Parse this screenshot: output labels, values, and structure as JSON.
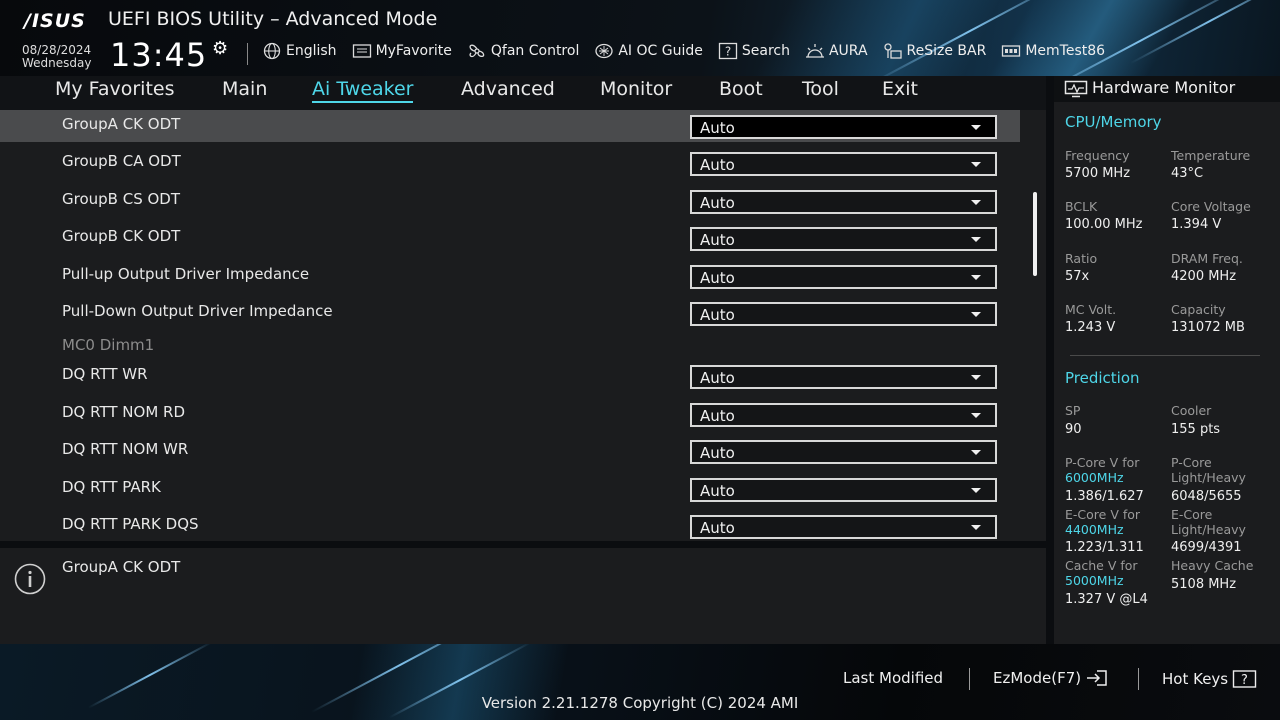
{
  "header": {
    "logo": "/ISUS",
    "title": "UEFI BIOS Utility – Advanced Mode",
    "date": "08/28/2024",
    "weekday": "Wednesday",
    "time": "13:45",
    "toolbar": [
      {
        "label": "English",
        "icon": "globe-icon"
      },
      {
        "label": "MyFavorite",
        "icon": "favorite-icon"
      },
      {
        "label": "Qfan Control",
        "icon": "fan-icon"
      },
      {
        "label": "AI OC Guide",
        "icon": "ai-oc-guide-icon"
      },
      {
        "label": "Search",
        "icon": "search-icon"
      },
      {
        "label": "AURA",
        "icon": "aura-icon"
      },
      {
        "label": "ReSize BAR",
        "icon": "resize-bar-icon"
      },
      {
        "label": "MemTest86",
        "icon": "memtest-icon"
      }
    ]
  },
  "tabs": [
    "My Favorites",
    "Main",
    "Ai Tweaker",
    "Advanced",
    "Monitor",
    "Boot",
    "Tool",
    "Exit"
  ],
  "active_tab": "Ai Tweaker",
  "settings": {
    "rows": [
      {
        "label": "GroupA CK ODT",
        "value": "Auto",
        "selected": true
      },
      {
        "label": "GroupB CA ODT",
        "value": "Auto"
      },
      {
        "label": "GroupB CS ODT",
        "value": "Auto"
      },
      {
        "label": "GroupB CK ODT",
        "value": "Auto"
      },
      {
        "label": "Pull-up Output Driver Impedance",
        "value": "Auto"
      },
      {
        "label": "Pull-Down Output Driver Impedance",
        "value": "Auto"
      }
    ],
    "section": "MC0 Dimm1",
    "rows2": [
      {
        "label": "DQ RTT WR",
        "value": "Auto"
      },
      {
        "label": "DQ RTT NOM RD",
        "value": "Auto"
      },
      {
        "label": "DQ RTT NOM WR",
        "value": "Auto"
      },
      {
        "label": "DQ RTT PARK",
        "value": "Auto"
      },
      {
        "label": "DQ RTT PARK DQS",
        "value": "Auto"
      }
    ]
  },
  "help": {
    "text": "GroupA CK ODT"
  },
  "hardware_monitor": {
    "title": "Hardware Monitor",
    "cpu_memory": {
      "heading": "CPU/Memory",
      "frequency_label": "Frequency",
      "frequency": "5700 MHz",
      "temperature_label": "Temperature",
      "temperature": "43°C",
      "bclk_label": "BCLK",
      "bclk": "100.00 MHz",
      "core_voltage_label": "Core Voltage",
      "core_voltage": "1.394 V",
      "ratio_label": "Ratio",
      "ratio": "57x",
      "dram_freq_label": "DRAM Freq.",
      "dram_freq": "4200 MHz",
      "mc_volt_label": "MC Volt.",
      "mc_volt": "1.243 V",
      "capacity_label": "Capacity",
      "capacity": "131072 MB"
    },
    "prediction": {
      "heading": "Prediction",
      "sp_label": "SP",
      "sp": "90",
      "cooler_label": "Cooler",
      "cooler": "155 pts",
      "pcore_label": "P-Core V for",
      "pcore_freq": "6000MHz",
      "pcore_v": "1.386/1.627",
      "pcore_lh_label1": "P-Core",
      "pcore_lh_label2": "Light/Heavy",
      "pcore_lh": "6048/5655",
      "ecore_label": "E-Core V for",
      "ecore_freq": "4400MHz",
      "ecore_v": "1.223/1.311",
      "ecore_lh_label1": "E-Core",
      "ecore_lh_label2": "Light/Heavy",
      "ecore_lh": "4699/4391",
      "cache_label": "Cache V for",
      "cache_freq": "5000MHz",
      "cache_v": "1.327 V @L4",
      "heavy_cache_label": "Heavy Cache",
      "heavy_cache": "5108 MHz"
    }
  },
  "footer": {
    "last_modified": "Last Modified",
    "ezmode": "EzMode(F7)",
    "hot_keys": "Hot Keys",
    "version": "Version 2.21.1278 Copyright (C) 2024 AMI"
  },
  "colors": {
    "accent": "#4ed6e8",
    "selected_row": "#4a4b4d",
    "panel": "#1b1c1e"
  }
}
